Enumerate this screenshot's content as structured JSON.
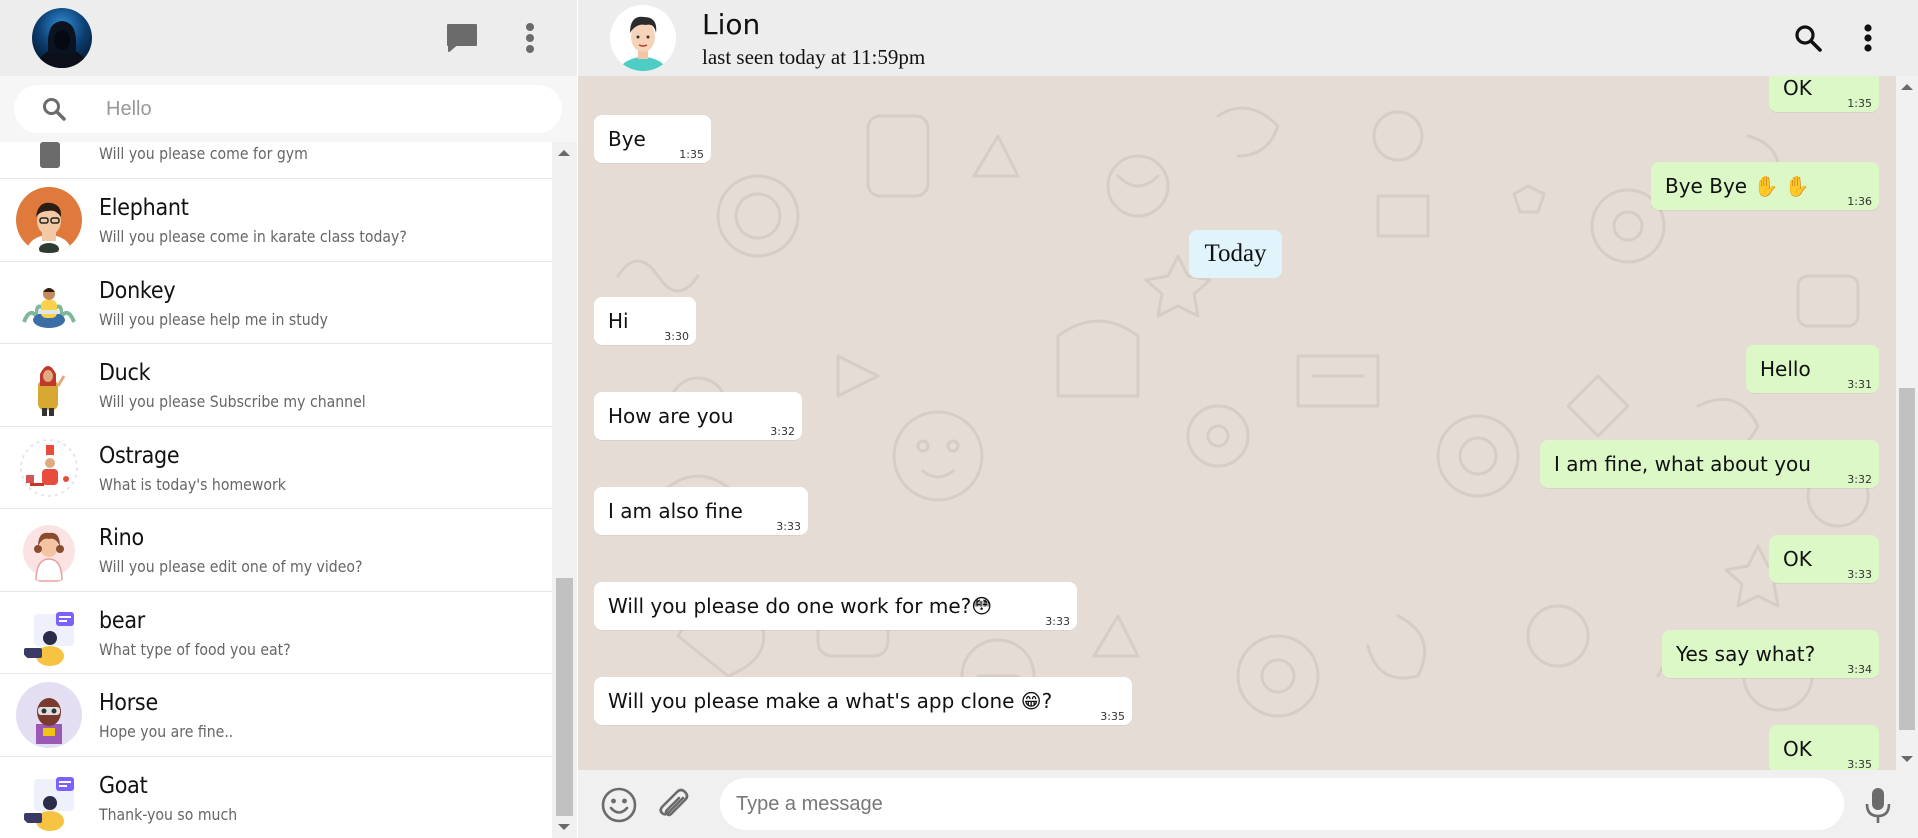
{
  "colors": {
    "header_bg": "#ededed",
    "wallpaper": "#e5ddd5",
    "incoming_bubble": "#ffffff",
    "outgoing_bubble": "#dcf8c6",
    "day_pill": "#e1f3fb"
  },
  "left_header": {
    "icons": [
      "profile-avatar",
      "chat-icon",
      "more-vert-icon"
    ]
  },
  "search": {
    "value": "Hello",
    "icon": "search-icon"
  },
  "chats": [
    {
      "name": "",
      "preview": "Will you please come for gym"
    },
    {
      "name": "Elephant",
      "preview": "Will you please come in karate class today?"
    },
    {
      "name": "Donkey",
      "preview": "Will you please help me in study"
    },
    {
      "name": "Duck",
      "preview": "Will you please Subscribe my channel"
    },
    {
      "name": "Ostrage",
      "preview": "What is today's homework"
    },
    {
      "name": "Rino",
      "preview": "Will you please edit one of my video?"
    },
    {
      "name": "bear",
      "preview": "What type of food you eat?"
    },
    {
      "name": "Horse",
      "preview": "Hope you are fine.."
    },
    {
      "name": "Goat",
      "preview": "Thank-you so much"
    }
  ],
  "conversation": {
    "contact_name": "Lion",
    "last_seen": "last seen today at 11:59pm",
    "day_label": "Today",
    "messages": [
      {
        "dir": "out",
        "text": "OK",
        "time": "1:35"
      },
      {
        "dir": "in",
        "text": "Bye",
        "time": "1:35"
      },
      {
        "dir": "out",
        "text": "Bye Bye ✋ ✋",
        "time": "1:36"
      },
      {
        "dir": "in",
        "text": "Hi",
        "time": "3:30"
      },
      {
        "dir": "out",
        "text": "Hello",
        "time": "3:31"
      },
      {
        "dir": "in",
        "text": "How are you",
        "time": "3:32"
      },
      {
        "dir": "out",
        "text": "I am fine, what about you",
        "time": "3:32"
      },
      {
        "dir": "in",
        "text": "I am also fine",
        "time": "3:33"
      },
      {
        "dir": "out",
        "text": "OK",
        "time": "3:33"
      },
      {
        "dir": "in",
        "text": "Will you please do one work for me?😳",
        "time": "3:33"
      },
      {
        "dir": "out",
        "text": "Yes say what?",
        "time": "3:34"
      },
      {
        "dir": "in",
        "text": "Will you please make a what's app clone 😁?",
        "time": "3:35"
      },
      {
        "dir": "out",
        "text": "OK",
        "time": "3:35"
      }
    ]
  },
  "composer": {
    "placeholder": "Type a message",
    "icons": [
      "emoji-icon",
      "attach-icon",
      "mic-icon"
    ]
  }
}
